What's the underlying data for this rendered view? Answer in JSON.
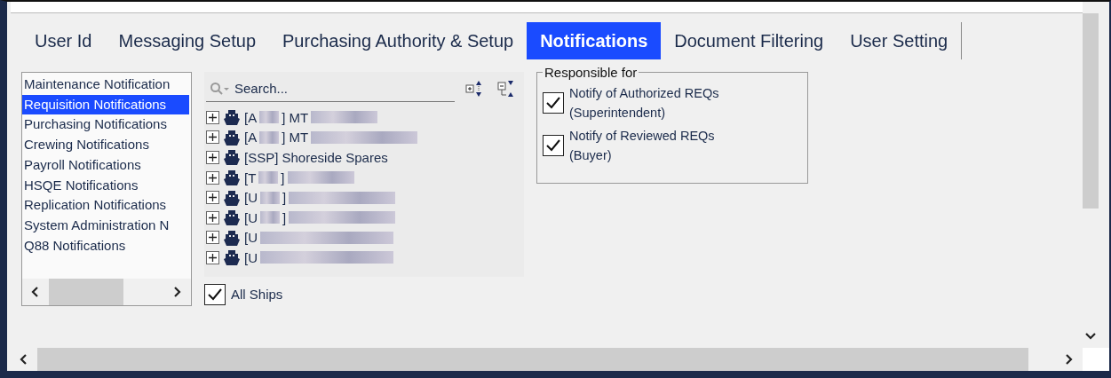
{
  "tabs": [
    {
      "label": "User Id",
      "selected": false
    },
    {
      "label": "Messaging Setup",
      "selected": false
    },
    {
      "label": "Purchasing Authority & Setup",
      "selected": false
    },
    {
      "label": "Notifications",
      "selected": true
    },
    {
      "label": "Document Filtering",
      "selected": false
    },
    {
      "label": "User Setting",
      "selected": false
    }
  ],
  "notification_types": [
    {
      "label": "Maintenance Notification",
      "selected": false
    },
    {
      "label": "Requisition Notifications",
      "selected": true
    },
    {
      "label": "Purchasing Notifications",
      "selected": false
    },
    {
      "label": "Crewing Notifications",
      "selected": false
    },
    {
      "label": "Payroll Notifications",
      "selected": false
    },
    {
      "label": "HSQE Notifications",
      "selected": false
    },
    {
      "label": "Replication Notifications",
      "selected": false
    },
    {
      "label": "System Administration N",
      "selected": false
    },
    {
      "label": "Q88 Notifications",
      "selected": false
    }
  ],
  "search": {
    "placeholder": "Search..."
  },
  "ships": [
    {
      "expanded": false,
      "parts": [
        {
          "kind": "text",
          "text": "[A"
        },
        {
          "kind": "blur_short"
        },
        {
          "kind": "text",
          "text": "] MT"
        },
        {
          "kind": "blur_medium"
        }
      ]
    },
    {
      "expanded": false,
      "parts": [
        {
          "kind": "text",
          "text": "[A"
        },
        {
          "kind": "blur_short"
        },
        {
          "kind": "text",
          "text": "] MT"
        },
        {
          "kind": "blur_long"
        }
      ]
    },
    {
      "expanded": false,
      "parts": [
        {
          "kind": "text",
          "text": "[SSP] Shoreside Spares"
        }
      ]
    },
    {
      "expanded": false,
      "parts": [
        {
          "kind": "text",
          "text": "[T"
        },
        {
          "kind": "blur_short"
        },
        {
          "kind": "text",
          "text": "]"
        },
        {
          "kind": "blur_medium"
        }
      ]
    },
    {
      "expanded": false,
      "parts": [
        {
          "kind": "text",
          "text": "[U"
        },
        {
          "kind": "blur_short"
        },
        {
          "kind": "text",
          "text": "]"
        },
        {
          "kind": "blur_long"
        }
      ]
    },
    {
      "expanded": false,
      "parts": [
        {
          "kind": "text",
          "text": "[U"
        },
        {
          "kind": "blur_short"
        },
        {
          "kind": "text",
          "text": "]"
        },
        {
          "kind": "blur_long"
        }
      ]
    },
    {
      "expanded": false,
      "parts": [
        {
          "kind": "text",
          "text": "[U"
        },
        {
          "kind": "blur_xlong"
        }
      ]
    },
    {
      "expanded": false,
      "parts": [
        {
          "kind": "text",
          "text": "[U"
        },
        {
          "kind": "blur_xlong"
        }
      ]
    }
  ],
  "all_ships": {
    "label": "All Ships",
    "checked": true
  },
  "responsible_for": {
    "title": "Responsible for",
    "options": [
      {
        "label": "Notify of Authorized REQs",
        "sublabel": "(Superintendent)",
        "checked": true
      },
      {
        "label": "Notify of Reviewed REQs",
        "sublabel": "(Buyer)",
        "checked": true
      }
    ]
  }
}
